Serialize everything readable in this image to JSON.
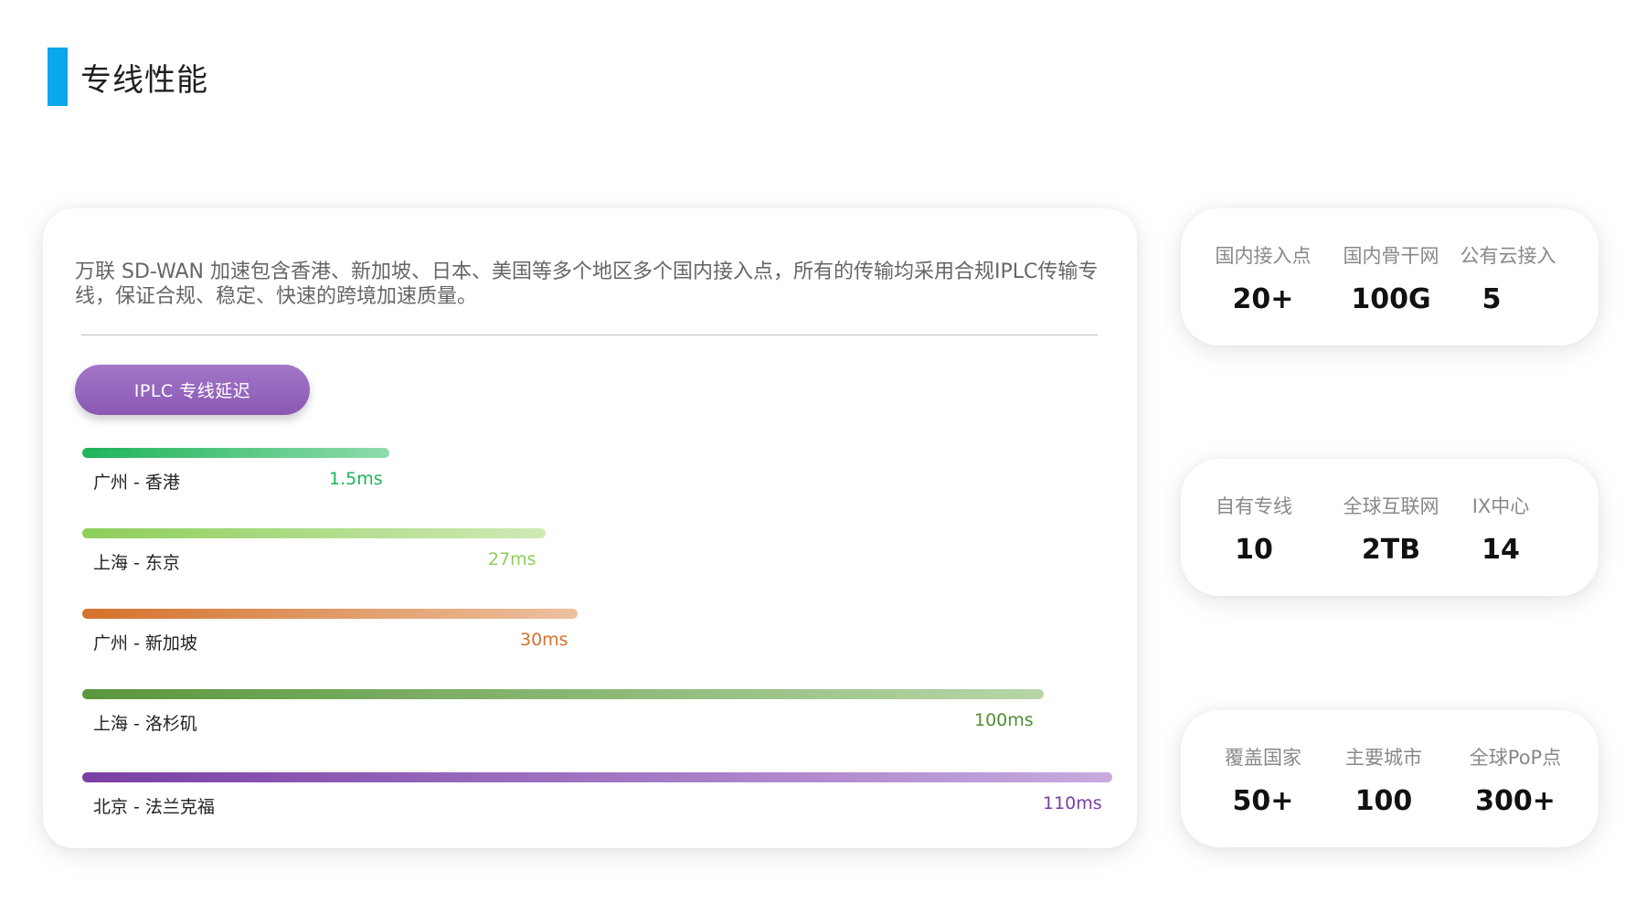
{
  "page": {
    "title": "专线性能"
  },
  "main_card": {
    "description": "万联 SD-WAN 加速包含香港、新加坡、日本、美国等多个地区多个国内接入点，所有的传输均采用合规IPLC传输专线，保证合规、稳定、快速的跨境加速质量。",
    "badge_label": "IPLC 专线延迟",
    "routes": [
      {
        "label": "广州 - 香港",
        "value": "1.5ms",
        "color": "#1db35b"
      },
      {
        "label": "上海 - 东京",
        "value": "27ms",
        "color": "#8dce5b"
      },
      {
        "label": "广州 - 新加坡",
        "value": "30ms",
        "color": "#d4722c"
      },
      {
        "label": "上海 - 洛杉矶",
        "value": "100ms",
        "color": "#5a963c"
      },
      {
        "label": "北京 - 法兰克福",
        "value": "110ms",
        "color": "#7a3fa5"
      }
    ]
  },
  "stats": [
    {
      "items": [
        {
          "label": "国内接入点",
          "value": "20+"
        },
        {
          "label": "国内骨干网",
          "value": "100G"
        },
        {
          "label": "公有云接入",
          "value": "5"
        }
      ]
    },
    {
      "items": [
        {
          "label": "自有专线",
          "value": "10"
        },
        {
          "label": "全球互联网",
          "value": "2TB"
        },
        {
          "label": "IX中心",
          "value": "14"
        }
      ]
    },
    {
      "items": [
        {
          "label": "覆盖国家",
          "value": "50+"
        },
        {
          "label": "主要城市",
          "value": "100"
        },
        {
          "label": "全球PoP点",
          "value": "300+"
        }
      ]
    }
  ]
}
